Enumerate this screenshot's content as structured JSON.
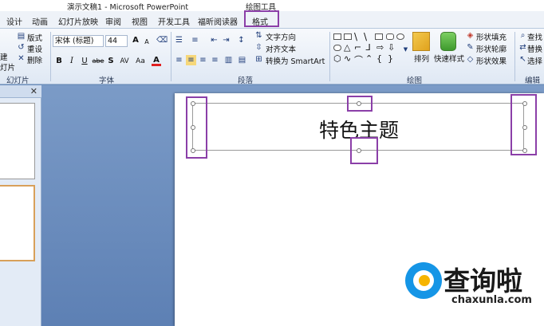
{
  "titlebar": {
    "title": "演示文稿1 - Microsoft PowerPoint",
    "context_title": "绘图工具"
  },
  "tabs": [
    {
      "label": "设计"
    },
    {
      "label": "动画"
    },
    {
      "label": "幻灯片放映"
    },
    {
      "label": "审阅"
    },
    {
      "label": "视图"
    },
    {
      "label": "开发工具"
    },
    {
      "label": "福昕阅读器"
    },
    {
      "label": "格式"
    }
  ],
  "ribbon": {
    "slides": {
      "layout": "版式",
      "reset": "重设",
      "delete": "删除",
      "new_slide_a": "建",
      "new_slide_b": "灯片",
      "group": "幻灯片"
    },
    "font": {
      "name": "宋体 (标题)",
      "size": "44",
      "grow": "A",
      "shrink": "A",
      "bold": "B",
      "italic": "I",
      "underline": "U",
      "strike": "abe",
      "shadow": "S",
      "spacing": "AV",
      "case": "Aa",
      "color": "A",
      "group": "字体"
    },
    "paragraph": {
      "text_direction": "文字方向",
      "align_text": "对齐文本",
      "smartart": "转换为 SmartArt",
      "group": "段落"
    },
    "drawing": {
      "arrange": "排列",
      "quick_styles": "快速样式",
      "shape_fill": "形状填充",
      "shape_outline": "形状轮廓",
      "shape_effects": "形状效果",
      "group": "绘图"
    },
    "editing": {
      "find": "查找",
      "replace": "替换",
      "select": "选择",
      "group": "编辑"
    }
  },
  "slide": {
    "title": "特色主题"
  },
  "watermark": {
    "name": "查询啦",
    "domain": "chaxunla.com"
  },
  "colors": {
    "highlight": "#8b3fa8",
    "canvas": "#6d8fbd",
    "font_color": "#e02020",
    "logo_blue": "#1595e6",
    "logo_yellow": "#f6b400"
  }
}
